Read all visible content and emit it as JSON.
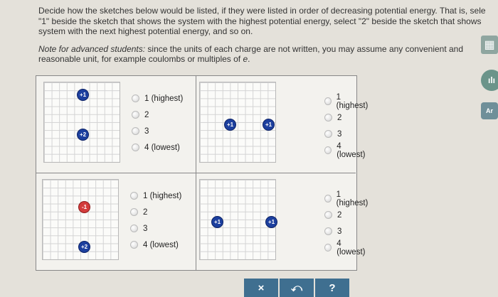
{
  "instructions": {
    "line1": "Decide how the sketches below would be listed, if they were listed in order of decreasing potential energy. That is, sele",
    "line2": "\"1\" beside the sketch that shows the system with the highest potential energy, select \"2\" beside the sketch that shows",
    "line3": "system with the next highest potential energy, and so on.",
    "note_lead": "Note for advanced students:",
    "note_line1": " since the units of each charge are not written, you may assume any convenient and",
    "note_line2": "reasonable unit, for example coulombs or multiples of ",
    "note_e": "e",
    "note_end": "."
  },
  "options": [
    "1 (highest)",
    "2",
    "3",
    "4 (lowest)"
  ],
  "sketches": [
    {
      "charges": [
        {
          "label": "+1",
          "sign": "pos"
        },
        {
          "label": "+2",
          "sign": "pos"
        }
      ]
    },
    {
      "charges": [
        {
          "label": "+1",
          "sign": "pos"
        },
        {
          "label": "+1",
          "sign": "pos"
        }
      ]
    },
    {
      "charges": [
        {
          "label": "-1",
          "sign": "neg"
        },
        {
          "label": "+2",
          "sign": "pos"
        }
      ]
    },
    {
      "charges": [
        {
          "label": "+1",
          "sign": "pos"
        },
        {
          "label": "+1",
          "sign": "pos"
        }
      ]
    }
  ],
  "toolbar": {
    "clear": "×",
    "undo": "⤺",
    "help": "?"
  },
  "side_tools": {
    "calculator_icon": "calculator-icon",
    "chart_icon": "bar-chart-icon",
    "periodic_icon": "periodic-table-icon",
    "periodic_text": "Ar"
  },
  "colors": {
    "positive_charge": "#1c3f9e",
    "negative_charge": "#d33b3b",
    "toolbar": "#3f6f90"
  }
}
